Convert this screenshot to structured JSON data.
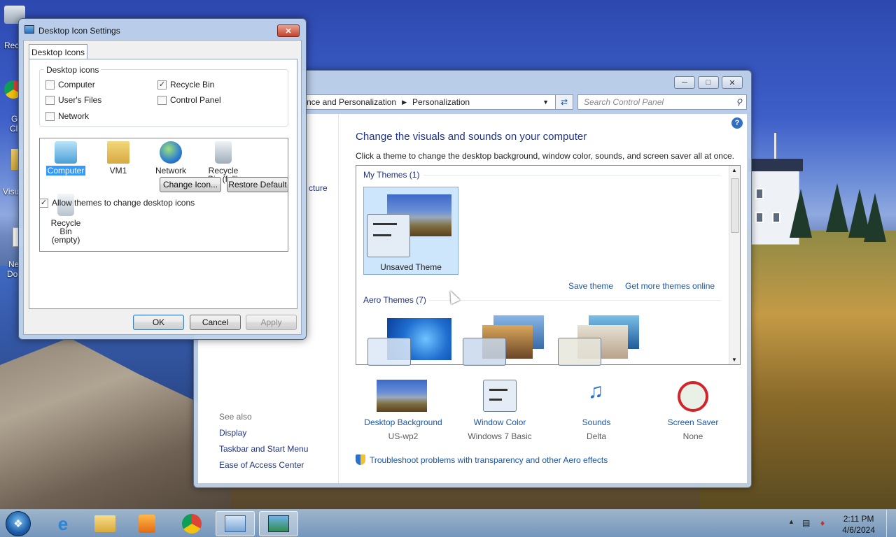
{
  "desktop": {
    "icons": [
      {
        "label": "Rec"
      },
      {
        "label": "G"
      },
      {
        "label": "Cl"
      },
      {
        "label": "Visu"
      },
      {
        "label": "Ne"
      },
      {
        "label": "Do"
      }
    ]
  },
  "control_panel": {
    "breadcrumb_parent": "nce and Personalization",
    "breadcrumb_current": "Personalization",
    "search_placeholder": "Search Control Panel",
    "left_fragment": "cture",
    "heading": "Change the visuals and sounds on your computer",
    "subheading": "Click a theme to change the desktop background, window color, sounds, and screen saver all at once.",
    "my_themes_label": "My Themes (1)",
    "selected_theme_label": "Unsaved Theme",
    "save_theme": "Save theme",
    "get_more": "Get more themes online",
    "aero_themes_label": "Aero Themes (7)",
    "bottom_items": [
      {
        "label": "Desktop Background",
        "value": "US-wp2"
      },
      {
        "label": "Window Color",
        "value": "Windows 7 Basic"
      },
      {
        "label": "Sounds",
        "value": "Delta"
      },
      {
        "label": "Screen Saver",
        "value": "None"
      }
    ],
    "troubleshoot": "Troubleshoot problems with transparency and other Aero effects",
    "see_also": "See also",
    "see_also_links": [
      "Display",
      "Taskbar and Start Menu",
      "Ease of Access Center"
    ]
  },
  "dialog": {
    "title": "Desktop Icon Settings",
    "tab": "Desktop Icons",
    "group_label": "Desktop icons",
    "checkboxes": [
      {
        "label": "Computer",
        "checked": false
      },
      {
        "label": "Recycle Bin",
        "checked": true
      },
      {
        "label": "User's Files",
        "checked": false
      },
      {
        "label": "Control Panel",
        "checked": false
      },
      {
        "label": "Network",
        "checked": false
      }
    ],
    "icon_items": [
      {
        "label": "Computer"
      },
      {
        "label": "VM1"
      },
      {
        "label": "Network"
      },
      {
        "label": "Recycle Bin (full)"
      },
      {
        "label": "Recycle Bin (empty)"
      }
    ],
    "change_icon": "Change Icon...",
    "restore_default": "Restore Default",
    "allow_themes": "Allow themes to change desktop icons",
    "allow_themes_checked": true,
    "ok": "OK",
    "cancel": "Cancel",
    "apply": "Apply"
  },
  "taskbar": {
    "time": "2:11 PM",
    "date": "4/6/2024"
  }
}
